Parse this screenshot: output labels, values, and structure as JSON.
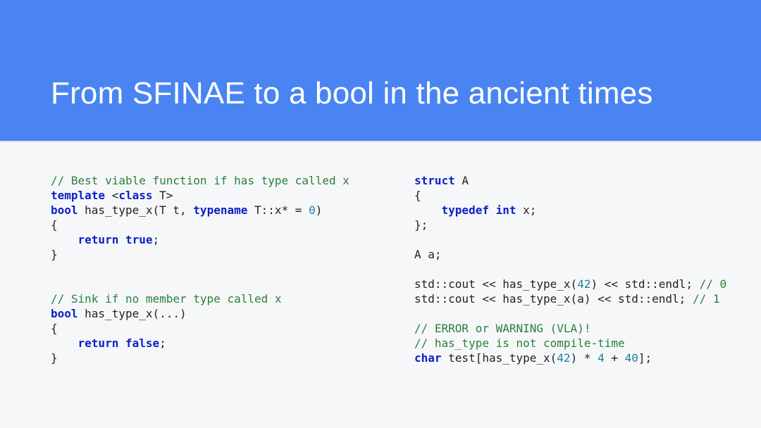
{
  "header": {
    "title": "From SFINAE to a bool in the ancient times"
  },
  "left": {
    "l1": "// Best viable function if has type called x",
    "l2a": "template ",
    "l2b": "<",
    "l2c": "class",
    "l2d": " T>",
    "l3a": "bool",
    "l3b": " has_type_x(T t, ",
    "l3c": "typename",
    "l3d": " T::x* = ",
    "l3e": "0",
    "l3f": ")",
    "l4": "{",
    "l5a": "    ",
    "l5b": "return true",
    "l5c": ";",
    "l6": "}",
    "l7": "",
    "l8": "",
    "l9": "// Sink if no member type called x",
    "l10a": "bool",
    "l10b": " has_type_x(...)",
    "l11": "{",
    "l12a": "    ",
    "l12b": "return false",
    "l12c": ";",
    "l13": "}"
  },
  "right": {
    "r1a": "struct",
    "r1b": " A",
    "r2": "{",
    "r3a": "    ",
    "r3b": "typedef int",
    "r3c": " x;",
    "r4": "};",
    "r5": "",
    "r6": "A a;",
    "r7": "",
    "r8a": "std::cout << has_type_x(",
    "r8b": "42",
    "r8c": ") << std::endl; ",
    "r8d": "// 0",
    "r9a": "std::cout << has_type_x(a) << std::endl; ",
    "r9b": "// 1",
    "r10": "",
    "r11": "// ERROR or WARNING (VLA)!",
    "r12": "// has_type is not compile-time",
    "r13a": "char",
    "r13b": " test[has_type_x(",
    "r13c": "42",
    "r13d": ") * ",
    "r13e": "4",
    "r13f": " + ",
    "r13g": "40",
    "r13h": "];"
  }
}
